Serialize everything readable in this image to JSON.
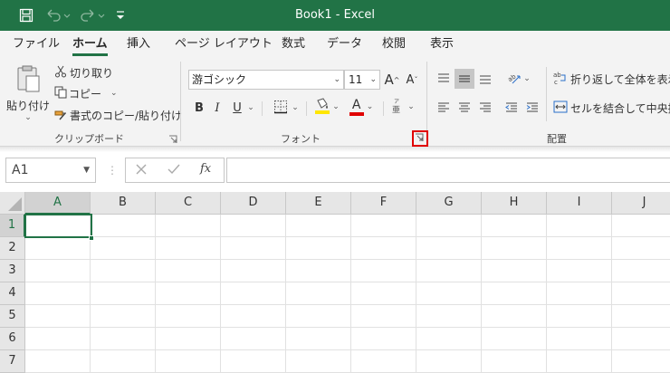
{
  "title_bar": {
    "title": "Book1  -  Excel",
    "save_icon": "save-icon",
    "undo_icon": "undo-icon",
    "redo_icon": "redo-icon",
    "customize_icon": "customize-qat-icon",
    "bg_color": "#217346"
  },
  "tabs": [
    "ファイル",
    "ホーム",
    "挿入",
    "ページ レイアウト",
    "数式",
    "データ",
    "校閲",
    "表示"
  ],
  "active_tab": "ホーム",
  "clipboard": {
    "paste_label": "貼り付け",
    "cut_label": "切り取り",
    "copy_label": "コピー",
    "format_painter_label": "書式のコピー/貼り付け",
    "group_label": "クリップボード"
  },
  "font": {
    "font_name": "游ゴシック",
    "font_size": "11",
    "bold": "B",
    "italic": "I",
    "underline": "U",
    "font_color_letter": "A",
    "group_label": "フォント"
  },
  "alignment": {
    "wrap_text_label": "折り返して全体を表示する",
    "merge_center_label": "セルを結合して中央揃え",
    "group_label": "配置"
  },
  "formula_bar": {
    "name_box": "A1",
    "fx": "fx",
    "formula": ""
  },
  "grid": {
    "columns": [
      "A",
      "B",
      "C",
      "D",
      "E",
      "F",
      "G",
      "H",
      "I",
      "J"
    ],
    "rows": [
      "1",
      "2",
      "3",
      "4",
      "5",
      "6",
      "7"
    ],
    "selected_cell": "A1",
    "accent": "#217346"
  },
  "highlight_color": "#e00000"
}
